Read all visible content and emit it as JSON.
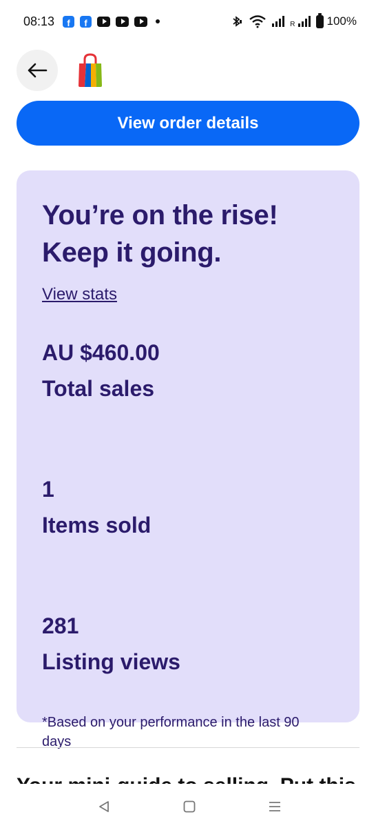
{
  "status_bar": {
    "time": "08:13",
    "battery": "100%",
    "roaming_label": "R",
    "notification_icons": [
      "facebook-icon",
      "facebook-icon",
      "youtube-icon",
      "youtube-icon",
      "youtube-icon"
    ]
  },
  "nav": {
    "back_icon": "arrow-left-icon",
    "logo_icon": "shopping-bag-logo"
  },
  "primary_button": {
    "label": "View order details",
    "color": "#0968f6"
  },
  "stats_card": {
    "background": "#e2defa",
    "text_color": "#2b1b6b",
    "heading_line1": "You’re on the rise!",
    "heading_line2": "Keep it going.",
    "link_label": "View stats",
    "metrics": [
      {
        "value": "AU $460.00",
        "label": "Total sales"
      },
      {
        "value": "1",
        "label": "Items sold"
      },
      {
        "value": "281",
        "label": "Listing views"
      }
    ],
    "footnote": "*Based on your performance in the last 90 days"
  },
  "next_section": {
    "partial_heading": "Your mini-guide to selling. Put this..."
  },
  "system_nav": {
    "back_icon": "triangle-back-icon",
    "home_icon": "square-home-icon",
    "recents_icon": "menu-lines-icon"
  }
}
